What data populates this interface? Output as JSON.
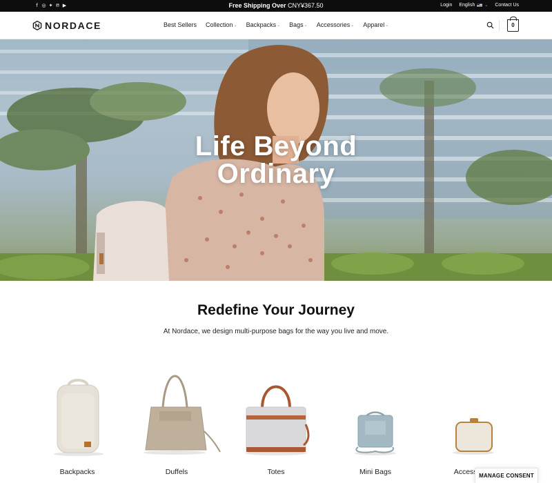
{
  "topbar": {
    "social_icons": [
      "facebook-icon",
      "instagram-icon",
      "twitter-icon",
      "pinterest-icon",
      "youtube-icon"
    ],
    "promo_bold": "Free Shipping Over",
    "promo_amount": " CNY¥367.50",
    "login": "Login",
    "language": "English",
    "contact": "Contact Us"
  },
  "header": {
    "logo_text": "NORDACE",
    "nav": [
      {
        "label": "Best Sellers",
        "has_dropdown": false
      },
      {
        "label": "Collection",
        "has_dropdown": true
      },
      {
        "label": "Backpacks",
        "has_dropdown": true
      },
      {
        "label": "Bags",
        "has_dropdown": true
      },
      {
        "label": "Accessories",
        "has_dropdown": true
      },
      {
        "label": "Apparel",
        "has_dropdown": true
      }
    ],
    "cart_count": "0"
  },
  "hero": {
    "line1": "Life Beyond",
    "line2": "Ordinary"
  },
  "intro": {
    "title": "Redefine Your Journey",
    "subtitle": "At Nordace, we design multi-purpose bags for the way you live and move."
  },
  "categories": [
    {
      "label": "Backpacks"
    },
    {
      "label": "Duffels"
    },
    {
      "label": "Totes"
    },
    {
      "label": "Mini Bags"
    },
    {
      "label": "Accessories"
    }
  ],
  "consent": {
    "label": "MANAGE CONSENT"
  },
  "colors": {
    "topbar_bg": "#0d0d0d",
    "text": "#111111"
  }
}
